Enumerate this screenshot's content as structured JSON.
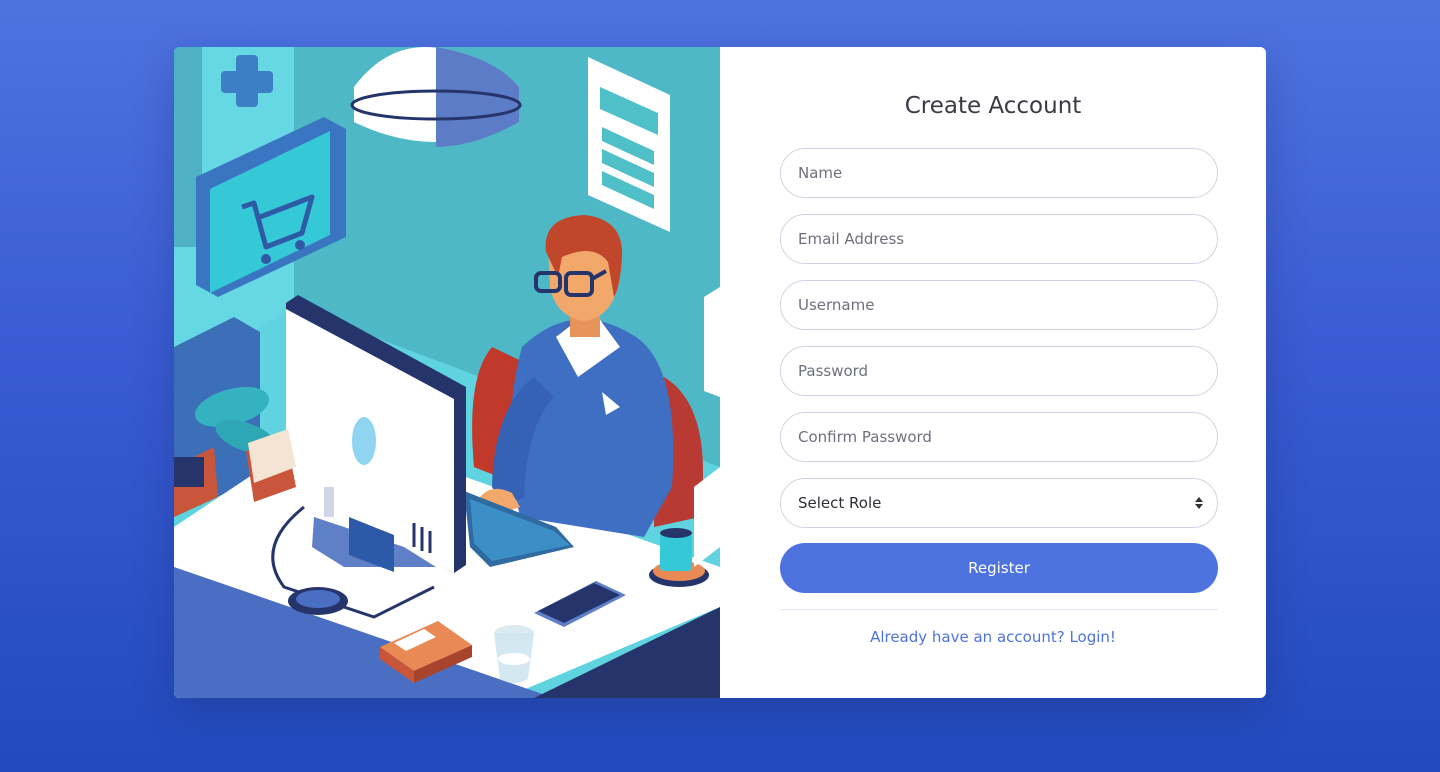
{
  "form": {
    "title": "Create Account",
    "name_placeholder": "Name",
    "email_placeholder": "Email Address",
    "username_placeholder": "Username",
    "password_placeholder": "Password",
    "confirm_password_placeholder": "Confirm Password",
    "role_selected": "Select Role",
    "register_label": "Register",
    "login_link": "Already have an account? Login!"
  },
  "icons": {
    "select": "sort-arrows-icon"
  },
  "colors": {
    "background_top": "#4e73df",
    "background_bottom": "#224abe",
    "primary": "#4e73df",
    "card": "#ffffff",
    "illustration_bg": "#5cc9d6"
  }
}
